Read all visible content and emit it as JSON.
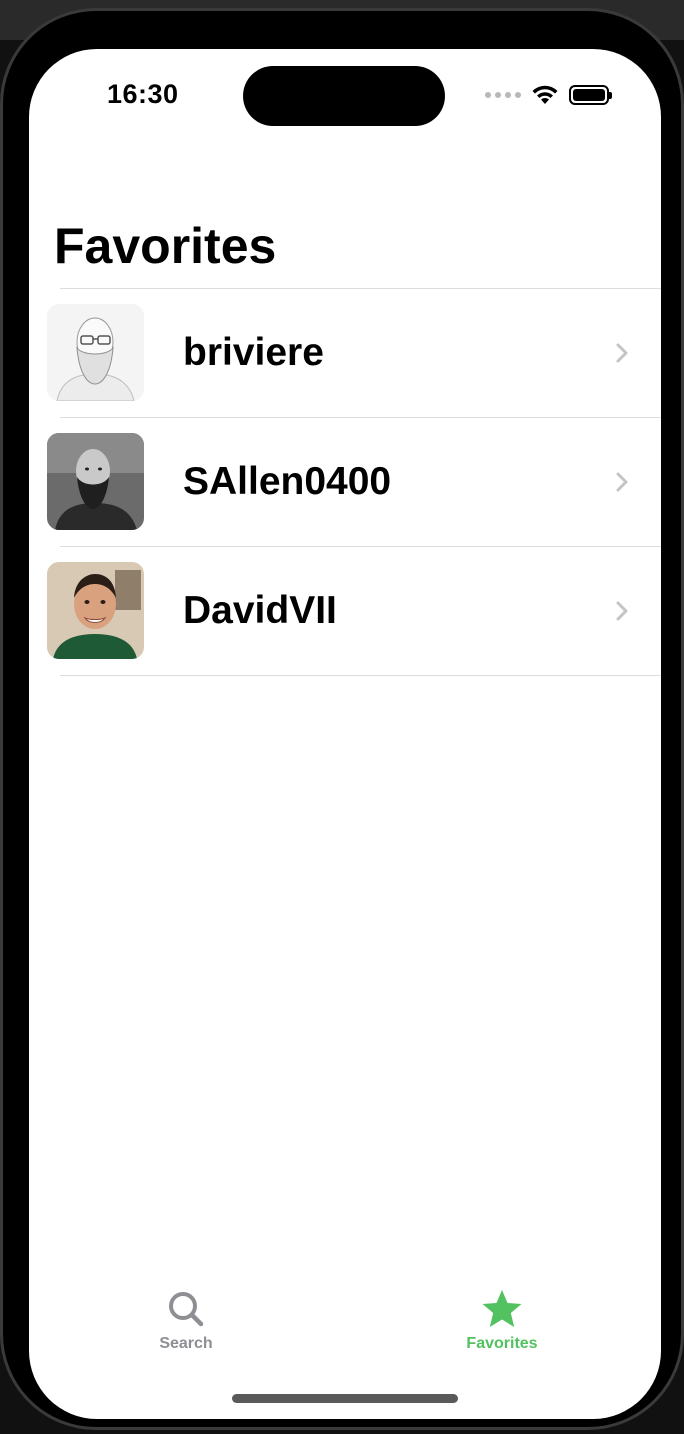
{
  "status_bar": {
    "time": "16:30",
    "icons": [
      "cellular-dots-icon",
      "wifi-icon",
      "battery-icon"
    ]
  },
  "page": {
    "title": "Favorites"
  },
  "favorites": [
    {
      "username": "briviere",
      "avatar": "sketch-bearded-man-with-glasses"
    },
    {
      "username": "SAllen0400",
      "avatar": "bw-photo-bearded-man"
    },
    {
      "username": "DavidVII",
      "avatar": "color-photo-smiling-man"
    }
  ],
  "tab_bar": {
    "tabs": [
      {
        "label": "Search",
        "icon": "magnifying-glass-icon",
        "selected": false
      },
      {
        "label": "Favorites",
        "icon": "star-icon",
        "selected": true
      }
    ],
    "selected_color": "#52c160",
    "unselected_color": "#8e8e93"
  }
}
